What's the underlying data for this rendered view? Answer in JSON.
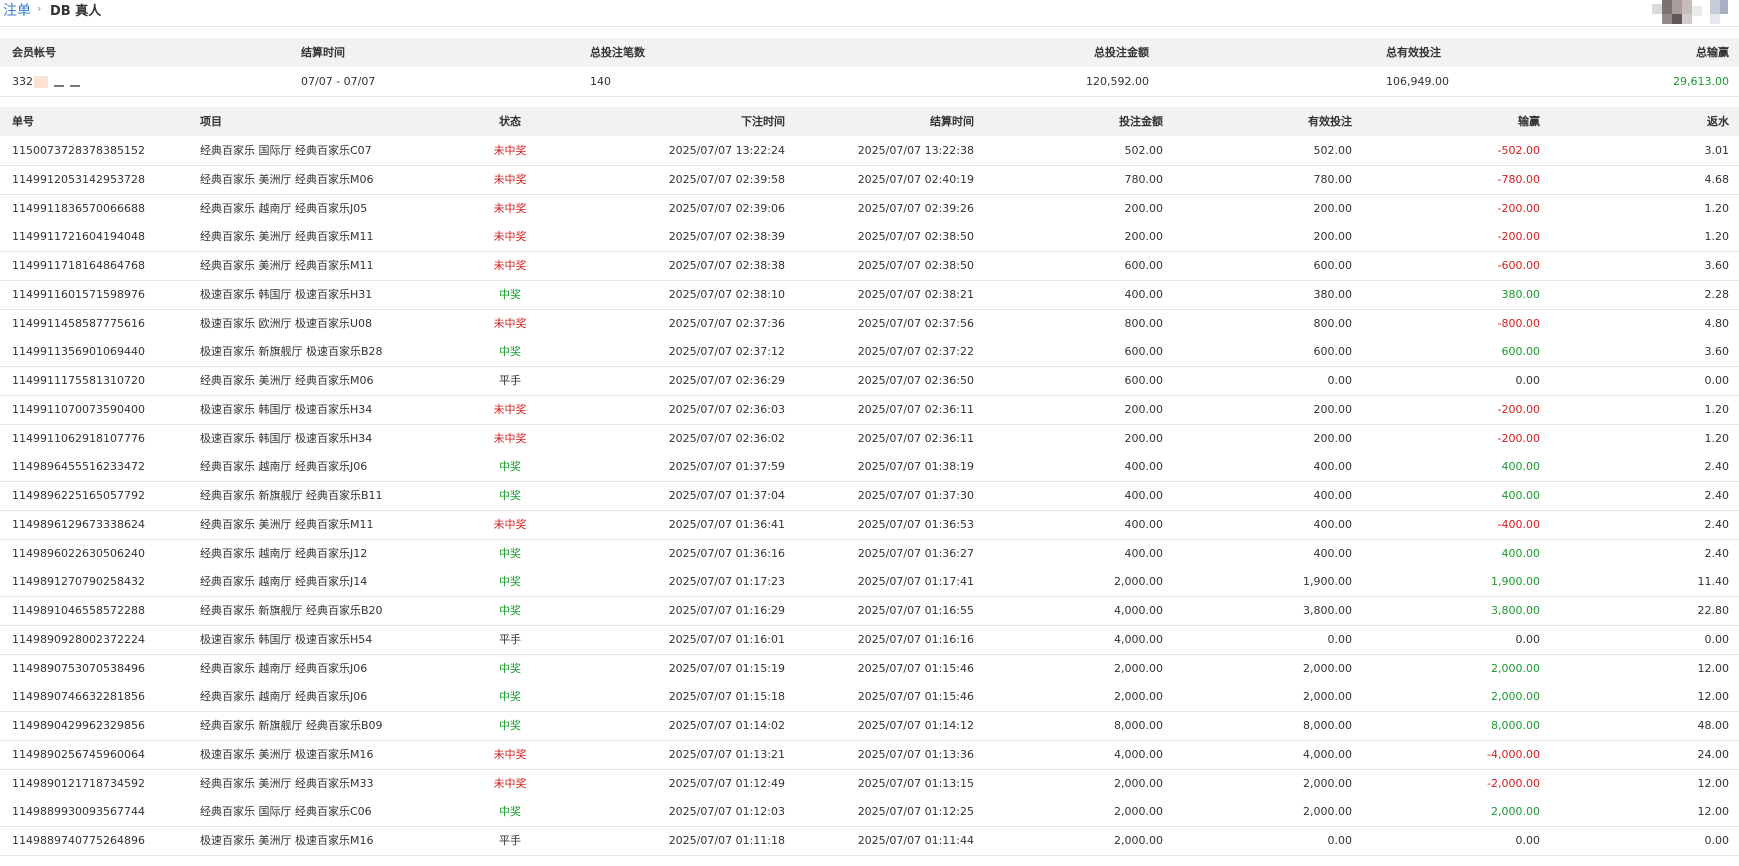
{
  "breadcrumb": {
    "parent": "注单",
    "separator": "›",
    "current": "DB 真人"
  },
  "summary": {
    "headers": [
      "会员帐号",
      "结算时间",
      "总投注笔数",
      "总投注金额",
      "总有效投注",
      "总输赢"
    ],
    "account_prefix": "332",
    "settle_range": "07/07 - 07/07",
    "bet_count": "140",
    "total_bet": "120,592.00",
    "total_valid": "106,949.00",
    "total_winloss": "29,613.00"
  },
  "table": {
    "headers": [
      "单号",
      "项目",
      "状态",
      "下注时间",
      "结算时间",
      "投注金额",
      "有效投注",
      "输赢",
      "返水"
    ],
    "rows": [
      {
        "id": "1150073728378385152",
        "item": "经典百家乐 国际厅 经典百家乐C07",
        "status": "未中奖",
        "st": "red",
        "bet_time": "2025/07/07 13:22:24",
        "settle_time": "2025/07/07 13:22:38",
        "amount": "502.00",
        "valid": "502.00",
        "winloss": "-502.00",
        "wl": "neg",
        "rebate": "3.01"
      },
      {
        "id": "1149912053142953728",
        "item": "经典百家乐 美洲厅 经典百家乐M06",
        "status": "未中奖",
        "st": "red",
        "bet_time": "2025/07/07 02:39:58",
        "settle_time": "2025/07/07 02:40:19",
        "amount": "780.00",
        "valid": "780.00",
        "winloss": "-780.00",
        "wl": "neg",
        "rebate": "4.68"
      },
      {
        "id": "1149911836570066688",
        "item": "经典百家乐 越南厅 经典百家乐J05",
        "status": "未中奖",
        "st": "red",
        "bet_time": "2025/07/07 02:39:06",
        "settle_time": "2025/07/07 02:39:26",
        "amount": "200.00",
        "valid": "200.00",
        "winloss": "-200.00",
        "wl": "neg",
        "rebate": "1.20"
      },
      {
        "id": "1149911721604194048",
        "item": "经典百家乐 美洲厅 经典百家乐M11",
        "status": "未中奖",
        "st": "red",
        "bet_time": "2025/07/07 02:38:39",
        "settle_time": "2025/07/07 02:38:50",
        "amount": "200.00",
        "valid": "200.00",
        "winloss": "-200.00",
        "wl": "neg",
        "rebate": "1.20"
      },
      {
        "id": "1149911718164864768",
        "item": "经典百家乐 美洲厅 经典百家乐M11",
        "status": "未中奖",
        "st": "red",
        "bet_time": "2025/07/07 02:38:38",
        "settle_time": "2025/07/07 02:38:50",
        "amount": "600.00",
        "valid": "600.00",
        "winloss": "-600.00",
        "wl": "neg",
        "rebate": "3.60"
      },
      {
        "id": "1149911601571598976",
        "item": "极速百家乐 韩国厅 极速百家乐H31",
        "status": "中奖",
        "st": "green",
        "bet_time": "2025/07/07 02:38:10",
        "settle_time": "2025/07/07 02:38:21",
        "amount": "400.00",
        "valid": "380.00",
        "winloss": "380.00",
        "wl": "pos",
        "rebate": "2.28"
      },
      {
        "id": "1149911458587775616",
        "item": "极速百家乐 欧洲厅 极速百家乐U08",
        "status": "未中奖",
        "st": "red",
        "bet_time": "2025/07/07 02:37:36",
        "settle_time": "2025/07/07 02:37:56",
        "amount": "800.00",
        "valid": "800.00",
        "winloss": "-800.00",
        "wl": "neg",
        "rebate": "4.80"
      },
      {
        "id": "1149911356901069440",
        "item": "极速百家乐 新旗舰厅 极速百家乐B28",
        "status": "中奖",
        "st": "green",
        "bet_time": "2025/07/07 02:37:12",
        "settle_time": "2025/07/07 02:37:22",
        "amount": "600.00",
        "valid": "600.00",
        "winloss": "600.00",
        "wl": "pos",
        "rebate": "3.60"
      },
      {
        "id": "1149911175581310720",
        "item": "经典百家乐 美洲厅 经典百家乐M06",
        "status": "平手",
        "st": "flat",
        "bet_time": "2025/07/07 02:36:29",
        "settle_time": "2025/07/07 02:36:50",
        "amount": "600.00",
        "valid": "0.00",
        "winloss": "0.00",
        "wl": "flat",
        "rebate": "0.00"
      },
      {
        "id": "1149911070073590400",
        "item": "极速百家乐 韩国厅 极速百家乐H34",
        "status": "未中奖",
        "st": "red",
        "bet_time": "2025/07/07 02:36:03",
        "settle_time": "2025/07/07 02:36:11",
        "amount": "200.00",
        "valid": "200.00",
        "winloss": "-200.00",
        "wl": "neg",
        "rebate": "1.20"
      },
      {
        "id": "1149911062918107776",
        "item": "极速百家乐 韩国厅 极速百家乐H34",
        "status": "未中奖",
        "st": "red",
        "bet_time": "2025/07/07 02:36:02",
        "settle_time": "2025/07/07 02:36:11",
        "amount": "200.00",
        "valid": "200.00",
        "winloss": "-200.00",
        "wl": "neg",
        "rebate": "1.20"
      },
      {
        "id": "1149896455516233472",
        "item": "经典百家乐 越南厅 经典百家乐J06",
        "status": "中奖",
        "st": "green",
        "bet_time": "2025/07/07 01:37:59",
        "settle_time": "2025/07/07 01:38:19",
        "amount": "400.00",
        "valid": "400.00",
        "winloss": "400.00",
        "wl": "pos",
        "rebate": "2.40"
      },
      {
        "id": "1149896225165057792",
        "item": "经典百家乐 新旗舰厅 经典百家乐B11",
        "status": "中奖",
        "st": "green",
        "bet_time": "2025/07/07 01:37:04",
        "settle_time": "2025/07/07 01:37:30",
        "amount": "400.00",
        "valid": "400.00",
        "winloss": "400.00",
        "wl": "pos",
        "rebate": "2.40"
      },
      {
        "id": "1149896129673338624",
        "item": "经典百家乐 美洲厅 经典百家乐M11",
        "status": "未中奖",
        "st": "red",
        "bet_time": "2025/07/07 01:36:41",
        "settle_time": "2025/07/07 01:36:53",
        "amount": "400.00",
        "valid": "400.00",
        "winloss": "-400.00",
        "wl": "neg",
        "rebate": "2.40"
      },
      {
        "id": "1149896022630506240",
        "item": "经典百家乐 越南厅 经典百家乐J12",
        "status": "中奖",
        "st": "green",
        "bet_time": "2025/07/07 01:36:16",
        "settle_time": "2025/07/07 01:36:27",
        "amount": "400.00",
        "valid": "400.00",
        "winloss": "400.00",
        "wl": "pos",
        "rebate": "2.40"
      },
      {
        "id": "1149891270790258432",
        "item": "经典百家乐 越南厅 经典百家乐J14",
        "status": "中奖",
        "st": "green",
        "bet_time": "2025/07/07 01:17:23",
        "settle_time": "2025/07/07 01:17:41",
        "amount": "2,000.00",
        "valid": "1,900.00",
        "winloss": "1,900.00",
        "wl": "pos",
        "rebate": "11.40"
      },
      {
        "id": "1149891046558572288",
        "item": "经典百家乐 新旗舰厅 经典百家乐B20",
        "status": "中奖",
        "st": "green",
        "bet_time": "2025/07/07 01:16:29",
        "settle_time": "2025/07/07 01:16:55",
        "amount": "4,000.00",
        "valid": "3,800.00",
        "winloss": "3,800.00",
        "wl": "pos",
        "rebate": "22.80"
      },
      {
        "id": "1149890928002372224",
        "item": "极速百家乐 韩国厅 极速百家乐H54",
        "status": "平手",
        "st": "flat",
        "bet_time": "2025/07/07 01:16:01",
        "settle_time": "2025/07/07 01:16:16",
        "amount": "4,000.00",
        "valid": "0.00",
        "winloss": "0.00",
        "wl": "flat",
        "rebate": "0.00"
      },
      {
        "id": "1149890753070538496",
        "item": "经典百家乐 越南厅 经典百家乐J06",
        "status": "中奖",
        "st": "green",
        "bet_time": "2025/07/07 01:15:19",
        "settle_time": "2025/07/07 01:15:46",
        "amount": "2,000.00",
        "valid": "2,000.00",
        "winloss": "2,000.00",
        "wl": "pos",
        "rebate": "12.00"
      },
      {
        "id": "1149890746632281856",
        "item": "经典百家乐 越南厅 经典百家乐J06",
        "status": "中奖",
        "st": "green",
        "bet_time": "2025/07/07 01:15:18",
        "settle_time": "2025/07/07 01:15:46",
        "amount": "2,000.00",
        "valid": "2,000.00",
        "winloss": "2,000.00",
        "wl": "pos",
        "rebate": "12.00"
      },
      {
        "id": "1149890429962329856",
        "item": "经典百家乐 新旗舰厅 经典百家乐B09",
        "status": "中奖",
        "st": "green",
        "bet_time": "2025/07/07 01:14:02",
        "settle_time": "2025/07/07 01:14:12",
        "amount": "8,000.00",
        "valid": "8,000.00",
        "winloss": "8,000.00",
        "wl": "pos",
        "rebate": "48.00"
      },
      {
        "id": "1149890256745960064",
        "item": "极速百家乐 美洲厅 极速百家乐M16",
        "status": "未中奖",
        "st": "red",
        "bet_time": "2025/07/07 01:13:21",
        "settle_time": "2025/07/07 01:13:36",
        "amount": "4,000.00",
        "valid": "4,000.00",
        "winloss": "-4,000.00",
        "wl": "neg",
        "rebate": "24.00"
      },
      {
        "id": "1149890121718734592",
        "item": "经典百家乐 美洲厅 经典百家乐M33",
        "status": "未中奖",
        "st": "red",
        "bet_time": "2025/07/07 01:12:49",
        "settle_time": "2025/07/07 01:13:15",
        "amount": "2,000.00",
        "valid": "2,000.00",
        "winloss": "-2,000.00",
        "wl": "neg",
        "rebate": "12.00"
      },
      {
        "id": "1149889930093567744",
        "item": "经典百家乐 国际厅 经典百家乐C06",
        "status": "中奖",
        "st": "green",
        "bet_time": "2025/07/07 01:12:03",
        "settle_time": "2025/07/07 01:12:25",
        "amount": "2,000.00",
        "valid": "2,000.00",
        "winloss": "2,000.00",
        "wl": "pos",
        "rebate": "12.00"
      },
      {
        "id": "1149889740775264896",
        "item": "极速百家乐 美洲厅 极速百家乐M16",
        "status": "平手",
        "st": "flat",
        "bet_time": "2025/07/07 01:11:18",
        "settle_time": "2025/07/07 01:11:44",
        "amount": "2,000.00",
        "valid": "0.00",
        "winloss": "0.00",
        "wl": "flat",
        "rebate": "0.00"
      }
    ]
  }
}
